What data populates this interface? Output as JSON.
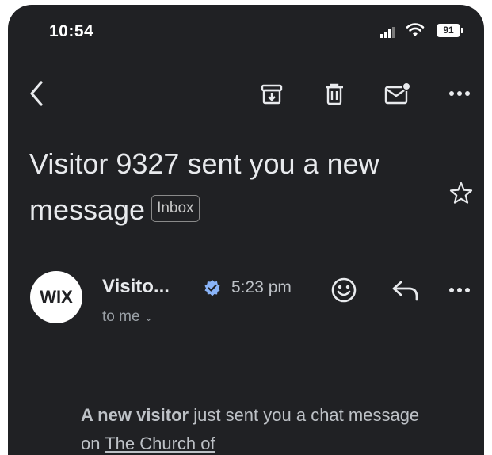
{
  "status_bar": {
    "time": "10:54",
    "battery": "91"
  },
  "toolbar": {
    "back_icon": "chevron-left-icon",
    "archive_icon": "archive-icon",
    "delete_icon": "trash-icon",
    "mark_unread_icon": "mail-unread-icon",
    "more_icon": "more-horizontal-icon"
  },
  "email": {
    "subject": "Visitor 9327 sent you a new message",
    "label": "Inbox",
    "sender": {
      "avatar_text": "WIX",
      "name": "Visito...",
      "time": "5:23 pm",
      "recipient": "to me"
    },
    "body": {
      "bold_lead": "A new visitor",
      "text": " just sent you a chat message on ",
      "link": "The Church of"
    }
  },
  "colors": {
    "background": "#202124",
    "text": "#e8eaed",
    "verified": "#8ab4f8"
  }
}
